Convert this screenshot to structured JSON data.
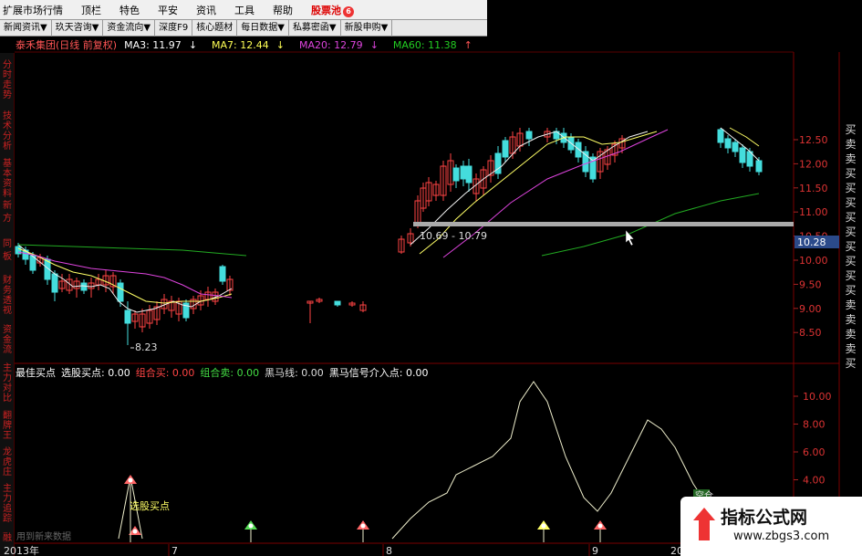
{
  "menu": {
    "items": [
      "扩展市场行情",
      "顶栏",
      "特色",
      "平安",
      "资讯",
      "工具",
      "帮助"
    ],
    "highlight": "股票池",
    "badge": "6"
  },
  "toolbar": {
    "buttons": [
      "新闻资讯▼",
      "玖天咨询▼",
      "资金流向▼",
      "深度F9",
      "核心题材",
      "每日数据▼",
      "私募密函▼",
      "新股申购▼"
    ]
  },
  "left_tabs": [
    "分时走势",
    "技术分析",
    "基本资料",
    "新",
    "方",
    "同",
    "板",
    "财务透视",
    "资金流",
    "主力对比",
    "翻牌王",
    "龙虎庄",
    "主力追踪",
    "融"
  ],
  "ma_line": {
    "stock": "泰禾集团(日线 前复权)",
    "ma3": "MA3: 11.97",
    "ma3_arrow": "↓",
    "ma7": "MA7: 12.44",
    "ma7_arrow": "↓",
    "ma20": "MA20: 12.79",
    "ma20_arrow": "↓",
    "ma60": "MA60: 11.38",
    "ma60_arrow": "↑"
  },
  "indicator_line": {
    "name": "最佳买点",
    "item1": "选股买点: 0.00",
    "item2": "组合买: 0.00",
    "item3": "组合卖: 0.00",
    "item4": "黑马线: 0.00",
    "item5": "黑马信号介入点: 0.00"
  },
  "price_axis": [
    "12.50",
    "12.00",
    "11.50",
    "11.00",
    "10.50",
    "10.00",
    "9.50",
    "9.00",
    "8.50"
  ],
  "price_current": "10.28",
  "indicator_axis": [
    "10.00",
    "8.00",
    "6.00",
    "4.00"
  ],
  "annotations": {
    "low_label": "8.23",
    "range_label": "10.69 - 10.79",
    "buy_label": "选股买点",
    "sell_label": "空仓",
    "bottom_text": "用到新来数据"
  },
  "right_buy_labels": [
    "买",
    "卖",
    "卖",
    "买",
    "买",
    "买",
    "买",
    "买",
    "买",
    "买",
    "买",
    "买",
    "卖",
    "卖",
    "卖",
    "卖",
    "买"
  ],
  "date_axis": {
    "year": "2013年",
    "months": [
      "7",
      "8",
      "9",
      "20"
    ]
  },
  "watermark": {
    "title": "指标公式网",
    "url": "www.zbgs3.com"
  },
  "colors": {
    "up": "#ff4444",
    "down": "#44dddd",
    "ma3": "#ffffff",
    "ma7": "#ffff55",
    "ma20": "#dd44dd",
    "ma60": "#22aa22"
  }
}
